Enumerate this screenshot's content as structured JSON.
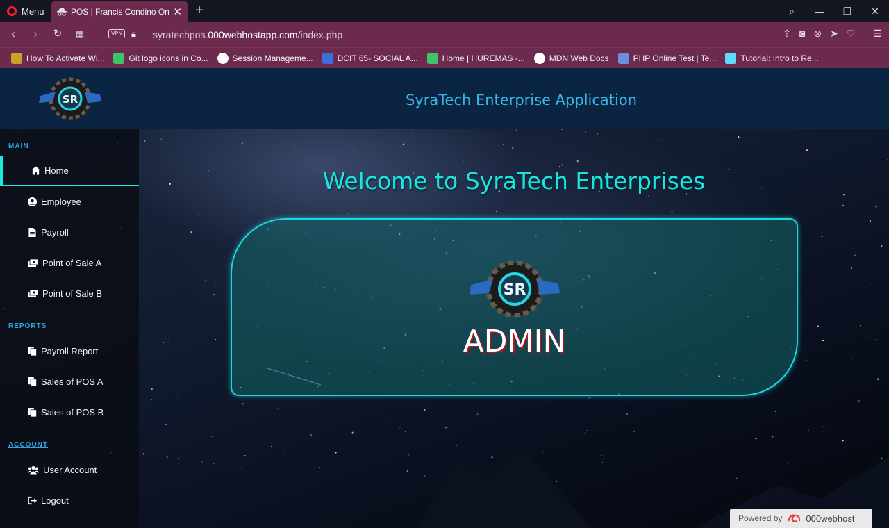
{
  "browser": {
    "menu_label": "Menu",
    "tab_title": "POS | Francis Condino Ong",
    "url_prefix": "syratechpos.",
    "url_domain": "000webhostapp.com",
    "url_path": "/index.php",
    "vpn_badge": "VPN",
    "bookmarks": [
      {
        "label": "How To Activate Wi...",
        "icon_color": "#c9a227"
      },
      {
        "label": "Git logo icons in Co...",
        "icon_color": "#3ac46b"
      },
      {
        "label": "Session Manageme...",
        "icon_color": "#ffffff"
      },
      {
        "label": "DCIT 65- SOCIAL A...",
        "icon_color": "#3b6fe0"
      },
      {
        "label": "Home | HUREMAS -...",
        "icon_color": "#3fc46a"
      },
      {
        "label": "MDN Web Docs",
        "icon_color": "#ffffff"
      },
      {
        "label": "PHP Online Test | Te...",
        "icon_color": "#6c8fd8"
      },
      {
        "label": "Tutorial: Intro to Re...",
        "icon_color": "#61dafb"
      }
    ]
  },
  "app": {
    "header_title": "SyraTech Enterprise Application",
    "sidebar": {
      "sections": {
        "main": "MAIN",
        "reports": "REPORTS",
        "account": "ACCOUNT"
      },
      "items": {
        "home": "Home",
        "employee": "Employee",
        "payroll": "Payroll",
        "pos_a": "Point of Sale A",
        "pos_b": "Point of Sale B",
        "payroll_report": "Payroll Report",
        "sales_pos_a": "Sales of POS A",
        "sales_pos_b": "Sales of POS B",
        "user_account": "User Account",
        "logout": "Logout"
      }
    },
    "welcome_text": "Welcome to SyraTech Enterprises",
    "role_label": "ADMIN",
    "powered_by": "Powered by",
    "powered_brand": "000webhost",
    "colors": {
      "accent": "#1de9e0",
      "header_bg": "#0b2442",
      "header_title": "#35b8e8",
      "tab_bg": "#6b2a4e"
    }
  }
}
